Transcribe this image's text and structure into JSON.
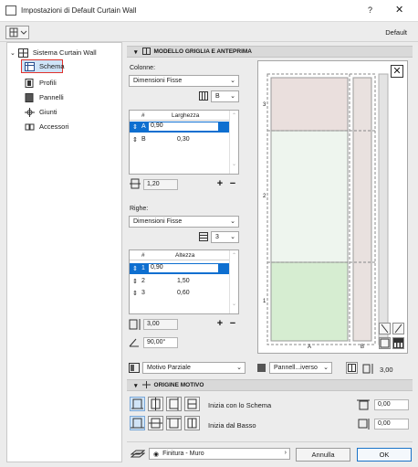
{
  "window": {
    "title": "Impostazioni di Default Curtain Wall",
    "help": "?",
    "close": "✕"
  },
  "toolbar": {
    "default_label": "Default"
  },
  "tree": {
    "root": "Sistema Curtain Wall",
    "items": [
      {
        "label": "Schema",
        "icon": "grid-icon",
        "selected": true
      },
      {
        "label": "Profili",
        "icon": "profile-icon"
      },
      {
        "label": "Pannelli",
        "icon": "panel-icon"
      },
      {
        "label": "Giunti",
        "icon": "junction-icon"
      },
      {
        "label": "Accessori",
        "icon": "accessory-icon"
      }
    ]
  },
  "grid_section": {
    "title": "MODELLO GRIGLIA E ANTEPRIMA",
    "columns": {
      "label": "Colonne:",
      "mode": "Dimensioni Fisse",
      "count": "B",
      "header_num": "#",
      "header_value": "Larghezza",
      "rows": [
        {
          "id": "A",
          "value": "0,90",
          "active": true
        },
        {
          "id": "B",
          "value": "0,30",
          "active": false
        }
      ],
      "total": "1,20"
    },
    "rows_cfg": {
      "label": "Righe:",
      "mode": "Dimensioni Fisse",
      "count": "3",
      "header_num": "#",
      "header_value": "Altezza",
      "rows": [
        {
          "id": "1",
          "value": "0,90",
          "active": true
        },
        {
          "id": "2",
          "value": "1,50",
          "active": false
        },
        {
          "id": "3",
          "value": "0,60",
          "active": false
        }
      ],
      "total": "3,00"
    },
    "angle": "90,00°",
    "plus": "+",
    "minus": "−",
    "preview": {
      "row_labels": [
        "3",
        "2",
        "1"
      ],
      "col_labels": [
        "A",
        "B"
      ],
      "close": "✕"
    },
    "pattern": {
      "mode": "Motivo Parziale",
      "panel_mode": "Pannell...iverso",
      "dim_value": "3,00"
    }
  },
  "origin_section": {
    "title": "ORIGINE MOTIVO",
    "start_scheme": "Inizia con lo Schema",
    "start_bottom": "Inizia dal Basso",
    "offset_x": "0,00",
    "offset_y": "0,00"
  },
  "footer": {
    "surface": "Finitura - Muro",
    "cancel": "Annulla",
    "ok": "OK"
  },
  "colors": {
    "selection": "#0e6fd0",
    "panel_top": "#eadfdd",
    "panel_mid": "#eef5ee",
    "panel_bottom": "#d6edd1",
    "highlight": "#e0332d"
  }
}
